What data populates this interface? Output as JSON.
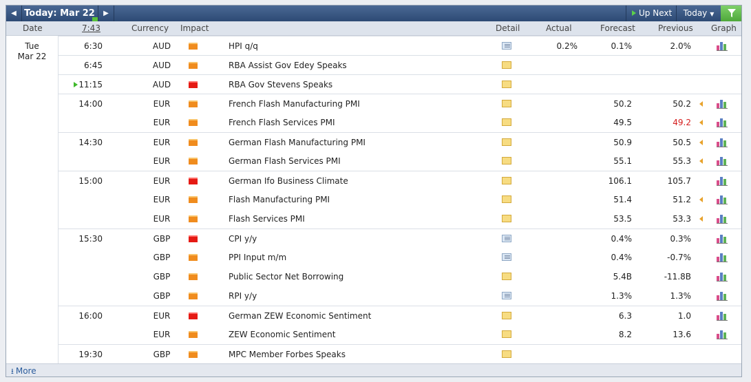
{
  "nav": {
    "prev_icon": "chevron-left-icon",
    "next_icon": "chevron-right-icon",
    "date_label": "Today: Mar 22",
    "up_next": "Up Next",
    "today": "Today",
    "filter_icon": "filter-icon"
  },
  "columns": {
    "date": "Date",
    "time": "7:43",
    "currency": "Currency",
    "impact": "Impact",
    "detail": "Detail",
    "actual": "Actual",
    "forecast": "Forecast",
    "previous": "Previous",
    "graph": "Graph"
  },
  "day": {
    "weekday": "Tue",
    "date": "Mar 22"
  },
  "colors": {
    "high_impact": "#e51a14",
    "medium_impact": "#f08c1e",
    "revised_red": "#d51d1d",
    "header_blue": "#2d4a74"
  },
  "events": [
    {
      "time": "6:30",
      "currency": "AUD",
      "impact": "medium",
      "event": "HPI q/q",
      "detail": "doc",
      "actual": "0.2%",
      "forecast": "0.1%",
      "previous": "2.0%",
      "revised": false,
      "graph": true
    },
    {
      "time": "6:45",
      "currency": "AUD",
      "impact": "medium",
      "event": "RBA Assist Gov Edey Speaks",
      "detail": "folder",
      "actual": "",
      "forecast": "",
      "previous": "",
      "revised": false,
      "graph": false
    },
    {
      "time": "11:15",
      "currency": "AUD",
      "impact": "high",
      "event": "RBA Gov Stevens Speaks",
      "detail": "folder",
      "actual": "",
      "forecast": "",
      "previous": "",
      "revised": false,
      "graph": false,
      "upnext": true
    },
    {
      "time": "14:00",
      "currency": "EUR",
      "impact": "medium",
      "event": "French Flash Manufacturing PMI",
      "detail": "folder",
      "actual": "",
      "forecast": "50.2",
      "previous": "50.2",
      "revised": true,
      "graph": true
    },
    {
      "time": "",
      "currency": "EUR",
      "impact": "medium",
      "event": "French Flash Services PMI",
      "detail": "folder",
      "actual": "",
      "forecast": "49.5",
      "previous": "49.2",
      "revised": true,
      "prev_red": true,
      "graph": true
    },
    {
      "time": "14:30",
      "currency": "EUR",
      "impact": "medium",
      "event": "German Flash Manufacturing PMI",
      "detail": "folder",
      "actual": "",
      "forecast": "50.9",
      "previous": "50.5",
      "revised": true,
      "graph": true
    },
    {
      "time": "",
      "currency": "EUR",
      "impact": "medium",
      "event": "German Flash Services PMI",
      "detail": "folder",
      "actual": "",
      "forecast": "55.1",
      "previous": "55.3",
      "revised": true,
      "graph": true
    },
    {
      "time": "15:00",
      "currency": "EUR",
      "impact": "high",
      "event": "German Ifo Business Climate",
      "detail": "folder",
      "actual": "",
      "forecast": "106.1",
      "previous": "105.7",
      "revised": false,
      "graph": true
    },
    {
      "time": "",
      "currency": "EUR",
      "impact": "medium",
      "event": "Flash Manufacturing PMI",
      "detail": "folder",
      "actual": "",
      "forecast": "51.4",
      "previous": "51.2",
      "revised": true,
      "graph": true
    },
    {
      "time": "",
      "currency": "EUR",
      "impact": "medium",
      "event": "Flash Services PMI",
      "detail": "folder",
      "actual": "",
      "forecast": "53.5",
      "previous": "53.3",
      "revised": true,
      "graph": true
    },
    {
      "time": "15:30",
      "currency": "GBP",
      "impact": "high",
      "event": "CPI y/y",
      "detail": "doc",
      "actual": "",
      "forecast": "0.4%",
      "previous": "0.3%",
      "revised": false,
      "graph": true
    },
    {
      "time": "",
      "currency": "GBP",
      "impact": "medium",
      "event": "PPI Input m/m",
      "detail": "doc",
      "actual": "",
      "forecast": "0.4%",
      "previous": "-0.7%",
      "revised": false,
      "graph": true
    },
    {
      "time": "",
      "currency": "GBP",
      "impact": "medium",
      "event": "Public Sector Net Borrowing",
      "detail": "folder",
      "actual": "",
      "forecast": "5.4B",
      "previous": "-11.8B",
      "revised": false,
      "graph": true
    },
    {
      "time": "",
      "currency": "GBP",
      "impact": "medium",
      "event": "RPI y/y",
      "detail": "doc",
      "actual": "",
      "forecast": "1.3%",
      "previous": "1.3%",
      "revised": false,
      "graph": true
    },
    {
      "time": "16:00",
      "currency": "EUR",
      "impact": "high",
      "event": "German ZEW Economic Sentiment",
      "detail": "folder",
      "actual": "",
      "forecast": "6.3",
      "previous": "1.0",
      "revised": false,
      "graph": true
    },
    {
      "time": "",
      "currency": "EUR",
      "impact": "medium",
      "event": "ZEW Economic Sentiment",
      "detail": "folder",
      "actual": "",
      "forecast": "8.2",
      "previous": "13.6",
      "revised": false,
      "graph": true
    },
    {
      "time": "19:30",
      "currency": "GBP",
      "impact": "medium",
      "event": "MPC Member Forbes Speaks",
      "detail": "folder",
      "actual": "",
      "forecast": "",
      "previous": "",
      "revised": false,
      "graph": false
    }
  ],
  "footer": {
    "more": "More",
    "more_icon": "download-arrow-icon"
  }
}
